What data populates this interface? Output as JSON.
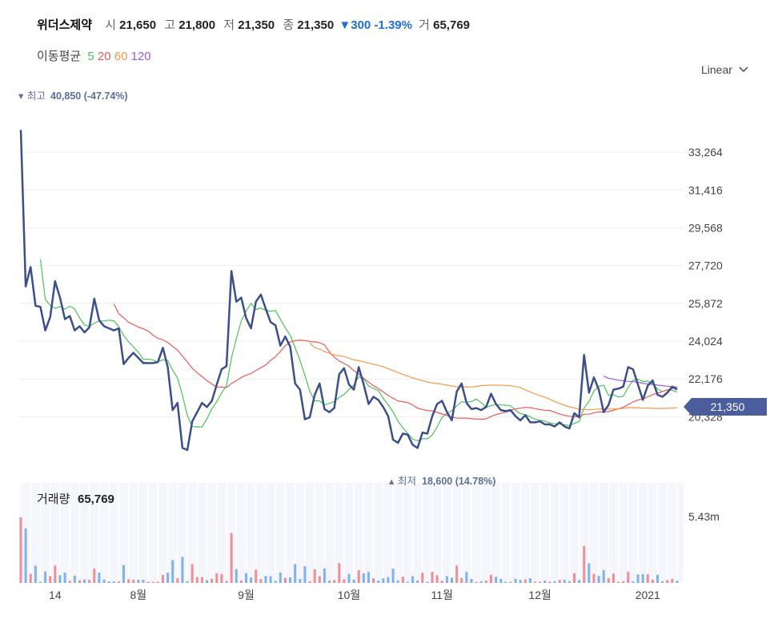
{
  "header": {
    "name": "위더스제약",
    "open_label": "시",
    "open": "21,650",
    "high_label": "고",
    "high": "21,800",
    "low_label": "저",
    "low": "21,350",
    "close_label": "종",
    "close": "21,350",
    "change": "300",
    "change_pct": "-1.39%",
    "volume_label": "거",
    "volume": "65,769"
  },
  "ma": {
    "label": "이동평균",
    "items": [
      {
        "period": "5",
        "color": "#4cc35a"
      },
      {
        "period": "20",
        "color": "#ee5a5a"
      },
      {
        "period": "60",
        "color": "#f29a4a"
      },
      {
        "period": "120",
        "color": "#9b5de5"
      }
    ]
  },
  "scale_toggle": {
    "label": "Linear"
  },
  "colors": {
    "price": "#3b4f8c",
    "up_vol": "#ee8f95",
    "down_vol": "#7fb2ee",
    "current_badge": "#4b5d9c",
    "grid": "#eeeeee",
    "vol_bg": "#f5f6fb"
  },
  "annotations": {
    "high": {
      "label": "최고",
      "value": "40,850 (-47.74%)"
    },
    "low": {
      "label": "최저",
      "value": "18,600 (14.78%)"
    }
  },
  "current_price_label": "21,350",
  "volume_panel": {
    "label": "거래량",
    "value": "65,769",
    "max_label": "5.43m"
  },
  "chart_data": {
    "type": "line",
    "y_ticks": [
      "33,264",
      "31,416",
      "29,568",
      "27,720",
      "25,872",
      "24,024",
      "22,176",
      "20,328"
    ],
    "ylim": [
      17600,
      36400
    ],
    "x_ticks": [
      {
        "label": "14",
        "index": 7
      },
      {
        "label": "8월",
        "index": 24
      },
      {
        "label": "9월",
        "index": 46
      },
      {
        "label": "10월",
        "index": 67
      },
      {
        "label": "11월",
        "index": 86
      },
      {
        "label": "12월",
        "index": 106
      },
      {
        "label": "2021",
        "index": 128
      }
    ],
    "price": [
      34350,
      26700,
      27650,
      25750,
      25700,
      24550,
      25200,
      26950,
      26150,
      25100,
      25250,
      24550,
      24750,
      24450,
      24700,
      26100,
      25050,
      24750,
      24650,
      24550,
      24650,
      22900,
      23200,
      23450,
      23200,
      22950,
      22950,
      22950,
      23000,
      23700,
      22750,
      20650,
      21000,
      18800,
      18700,
      20100,
      20550,
      21000,
      20800,
      21100,
      21900,
      22650,
      22800,
      27450,
      25950,
      26150,
      25150,
      24650,
      25950,
      26300,
      25600,
      24950,
      24800,
      23800,
      24250,
      23750,
      21950,
      21650,
      20200,
      20300,
      21400,
      21950,
      20700,
      20550,
      20750,
      22400,
      22700,
      21900,
      21650,
      22750,
      21900,
      20950,
      21300,
      21150,
      20800,
      20350,
      19200,
      19050,
      19500,
      19450,
      18950,
      18800,
      19550,
      19500,
      20350,
      20950,
      21100,
      20550,
      20150,
      21550,
      21950,
      21000,
      20700,
      20750,
      20650,
      20800,
      21450,
      20950,
      20650,
      20600,
      20650,
      20350,
      20150,
      20400,
      20050,
      20050,
      20100,
      19950,
      19950,
      19850,
      20050,
      19850,
      19750,
      20500,
      20300,
      23350,
      21500,
      22250,
      21650,
      20550,
      20900,
      21650,
      21700,
      21800,
      22750,
      22650,
      21900,
      21150,
      21850,
      22100,
      21400,
      21300,
      21500,
      21800,
      21650
    ]
  }
}
